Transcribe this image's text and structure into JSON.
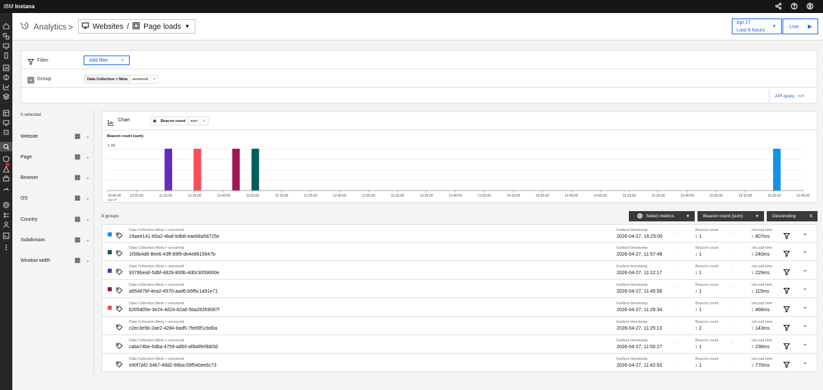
{
  "brand": {
    "ibm": "IBM",
    "product": "Instana"
  },
  "header": {
    "analytics": "Analytics",
    "crumb_sep": ">",
    "websites": "Websites",
    "slash": "/",
    "page_loads": "Page loads",
    "caret": "▼"
  },
  "timepicker": {
    "date": "Apr 27",
    "range": "Last 6 hours",
    "caret": "▼",
    "live": "Live",
    "play": "▶"
  },
  "filter": {
    "label": "Filter",
    "add_filter": "Add filter",
    "plus": "+"
  },
  "group": {
    "label": "Group",
    "path1": "Data Collection",
    "arrow": ">",
    "path2": "Meta",
    "value": "sessionid",
    "remove": "✕"
  },
  "api_query": {
    "label": "API query",
    "icon": "</>"
  },
  "sidebar": {
    "selected": "0 selected",
    "items": [
      {
        "label": "Website"
      },
      {
        "label": "Page"
      },
      {
        "label": "Browser"
      },
      {
        "label": "OS"
      },
      {
        "label": "Country"
      },
      {
        "label": "Subdivision"
      },
      {
        "label": "Window width"
      }
    ]
  },
  "chart_panel": {
    "label": "Chart",
    "metric": "Beacon count",
    "agg": "sum",
    "remove": "✕"
  },
  "chart_data": {
    "type": "bar",
    "ylabel": "Beacon count (sum)",
    "ymax_label": "1.00",
    "ylim": [
      0,
      1
    ],
    "xlim": [
      "10:40:00",
      "16:40:00"
    ],
    "ticks": [
      "10:40:00",
      "10:55:00",
      "11:10:00",
      "11:25:00",
      "11:40:00",
      "11:55:00",
      "12:10:00",
      "12:25:00",
      "12:40:00",
      "12:55:00",
      "13:10:00",
      "13:25:00",
      "13:40:00",
      "13:55:00",
      "14:10:00",
      "14:25:00",
      "14:40:00",
      "14:55:00",
      "15:10:00",
      "15:25:00",
      "15:40:00",
      "15:55:00",
      "16:10:00",
      "16:25:00",
      "16:40:00"
    ],
    "first_tick_date": "Apr 27",
    "bars": [
      {
        "time": "11:10:00",
        "value": 1,
        "color": "#6929c4"
      },
      {
        "time": "11:25:00",
        "value": 1,
        "color": "#fa4d56"
      },
      {
        "time": "11:45:00",
        "value": 1,
        "color": "#9f1853"
      },
      {
        "time": "11:55:00",
        "value": 1,
        "color": "#005d5d"
      },
      {
        "time": "16:25:00",
        "value": 1,
        "color": "#1192e8"
      }
    ]
  },
  "toolbar": {
    "groups": "8 groups",
    "select_metrics": "Select metrics",
    "metric": "Beacon count (sum)",
    "order": "Descending",
    "caret": "▼"
  },
  "columns": {
    "ts": "Earliest timestamp",
    "beacon": "Beacon count",
    "onload": "onLoad time",
    "sigma": "Σ",
    "dash": "-"
  },
  "rows": [
    {
      "group": "Data Collection.Meta > sessionid",
      "id": "19aee141-60a2-4baf-bdb8-eae68a58725e",
      "ts": "2026-04-27, 16:25:06",
      "beacon": "1",
      "onload": "807ms",
      "color": "#1192e8"
    },
    {
      "group": "Data Collection.Meta > sessionid",
      "id": "1f36b4d8-8ee6-43ff-89f9-de4e8615647b",
      "ts": "2026-04-27, 11:57:48",
      "beacon": "1",
      "onload": "240ms",
      "color": "#005d5d"
    },
    {
      "group": "Data Collection.Meta > sessionid",
      "id": "9378bea0-5dbf-4828-800b-4d0c3059660e",
      "ts": "2026-04-27, 11:12:17",
      "beacon": "1",
      "onload": "229ms",
      "color": "#6929c4"
    },
    {
      "group": "Data Collection.Meta > sessionid",
      "id": "a85467bf-4ea2-4570-aad6-b5f6c1a91e71",
      "ts": "2026-04-27, 11:45:58",
      "beacon": "1",
      "onload": "115ms",
      "color": "#9f1853"
    },
    {
      "group": "Data Collection.Meta > sessionid",
      "id": "b205d05e-3e24-4d19-82a8-5ba28359087f",
      "ts": "2026-04-27, 11:29:34",
      "beacon": "1",
      "onload": "468ms",
      "color": "#fa4d56"
    },
    {
      "group": "Data Collection.Meta > sessionid",
      "id": "c2ec3e5b-2ae2-4284-8ad5-7fe69f1cbd0a",
      "ts": "2026-04-27, 11:25:13",
      "beacon": "2",
      "onload": "143ms",
      "color": ""
    },
    {
      "group": "Data Collection.Meta > sessionid",
      "id": "caba74be-6dba-4759-ad60-af8a6fe5bb5d",
      "ts": "2026-04-27, 11:50:27",
      "beacon": "1",
      "onload": "238ms",
      "color": ""
    },
    {
      "group": "Data Collection.Meta > sessionid",
      "id": "e90f7af2-34b7-49d2-96ba-59f540ee6c73",
      "ts": "2026-04-27, 11:42:53",
      "beacon": "1",
      "onload": "770ms",
      "color": ""
    }
  ]
}
